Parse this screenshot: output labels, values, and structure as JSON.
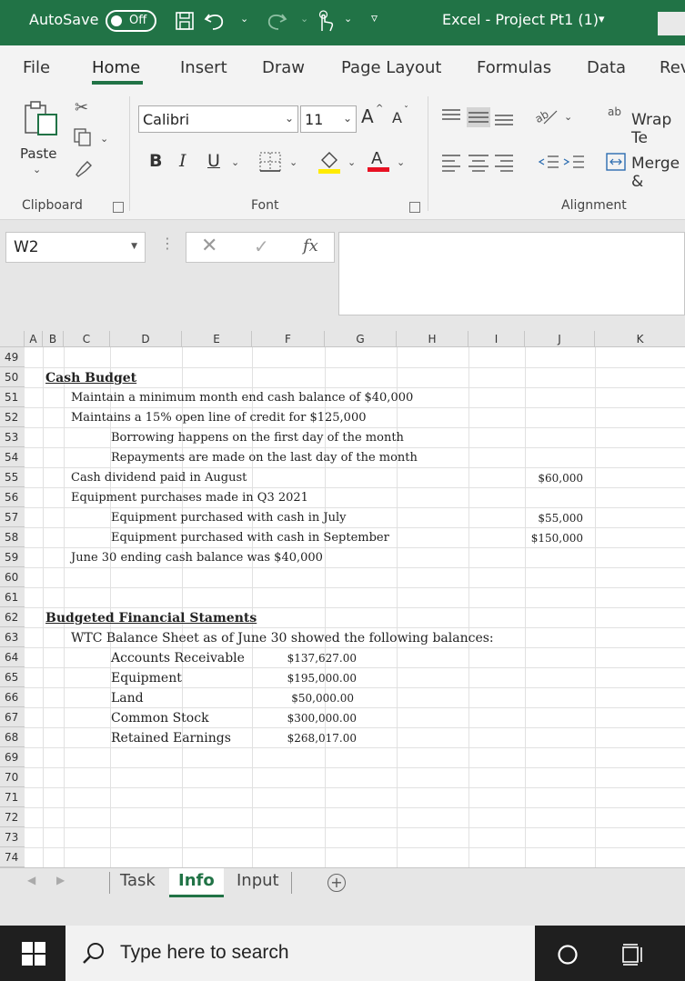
{
  "titlebar": {
    "autosave_label": "AutoSave",
    "autosave_state": "Off",
    "title": "Excel - Project Pt1 (1)",
    "title_caret": "▾"
  },
  "tabs": [
    "File",
    "Home",
    "Insert",
    "Draw",
    "Page Layout",
    "Formulas",
    "Data",
    "Rev"
  ],
  "ribbon": {
    "clipboard": {
      "paste_label": "Paste",
      "group_label": "Clipboard"
    },
    "font": {
      "font_name": "Calibri",
      "font_size": "11",
      "grow": "A",
      "shrink": "A",
      "bold": "B",
      "italic": "I",
      "underline": "U",
      "group_label": "Font"
    },
    "alignment": {
      "wrap_text": "Wrap Te",
      "merge": "Merge &",
      "group_label": "Alignment"
    }
  },
  "formula_bar": {
    "name_box": "W2",
    "fx": "fx",
    "cancel": "✕",
    "enter": "✓"
  },
  "columns": [
    "A",
    "B",
    "C",
    "D",
    "E",
    "F",
    "G",
    "H",
    "I",
    "J",
    "K"
  ],
  "rows": [
    "49",
    "50",
    "51",
    "52",
    "53",
    "54",
    "55",
    "56",
    "57",
    "58",
    "59",
    "60",
    "61",
    "62",
    "63",
    "64",
    "65",
    "66",
    "67",
    "68",
    "69",
    "70",
    "71",
    "72",
    "73",
    "74"
  ],
  "cells": {
    "r50_title": "Cash Budget",
    "r51": "Maintain a minimum month end cash balance of $40,000",
    "r52": "Maintains a 15% open line of credit for $125,000",
    "r53": "Borrowing happens on the first day of the month",
    "r54": "Repayments are made on the last day of the month",
    "r55": "Cash dividend paid in August",
    "r55_j": "$60,000",
    "r56": "Equipment purchases made in Q3 2021",
    "r57": "Equipment purchased with cash in July",
    "r57_j": "$55,000",
    "r58": "Equipment purchased with cash in September",
    "r58_j": "$150,000",
    "r59": "June 30 ending cash balance was $40,000",
    "r62_title": "Budgeted Financial Staments",
    "r63": "WTC Balance Sheet as of June 30 showed the following balances:",
    "r64": "Accounts Receivable",
    "r64_g": "$137,627.00",
    "r65": "Equipment",
    "r65_g": "$195,000.00",
    "r66": "Land",
    "r66_g": "$50,000.00",
    "r67": "Common Stock",
    "r67_g": "$300,000.00",
    "r68": "Retained Earnings",
    "r68_g": "$268,017.00"
  },
  "sheet_tabs": [
    "Task",
    "Info",
    "Input"
  ],
  "active_sheet": "Info",
  "add_sheet": "+",
  "taskbar": {
    "search_placeholder": "Type here to search"
  },
  "colors": {
    "accent": "#217346",
    "font_color_bar": "#e81123",
    "highlight_bar": "#ffeb00"
  }
}
